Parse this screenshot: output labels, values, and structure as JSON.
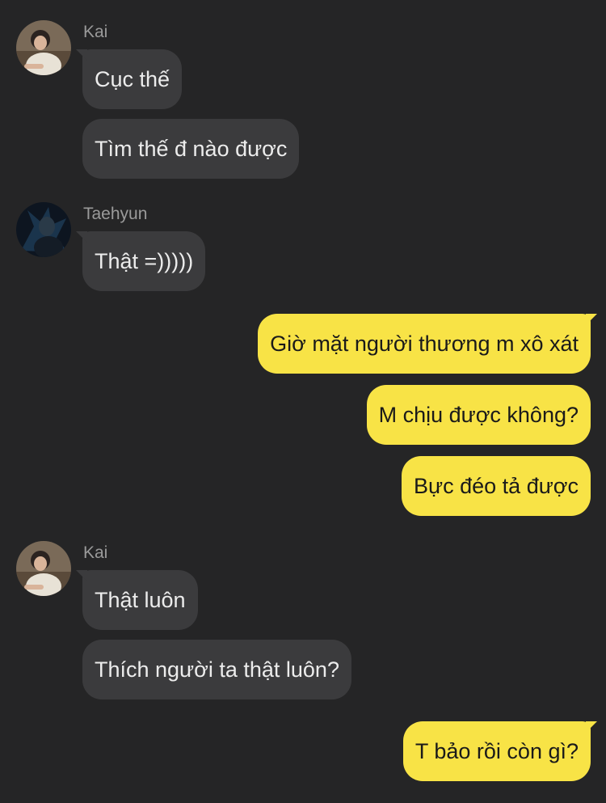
{
  "chat": {
    "sender_kai": "Kai",
    "sender_taehyun": "Taehyun",
    "msg1": "Cục thế",
    "msg2": "Tìm thế đ nào được",
    "msg3": "Thật =)))))",
    "msg4": "Giờ mặt người thương m xô xát",
    "msg5": "M chịu được không?",
    "msg6": "Bực đéo tả được",
    "msg7": "Thật luôn",
    "msg8": "Thích người ta thật luôn?",
    "msg9": "T bảo rồi còn gì?"
  },
  "colors": {
    "background": "#252526",
    "incoming_bubble": "#3b3b3d",
    "outgoing_bubble": "#f8e346",
    "sender_name": "#9a9a9a"
  }
}
